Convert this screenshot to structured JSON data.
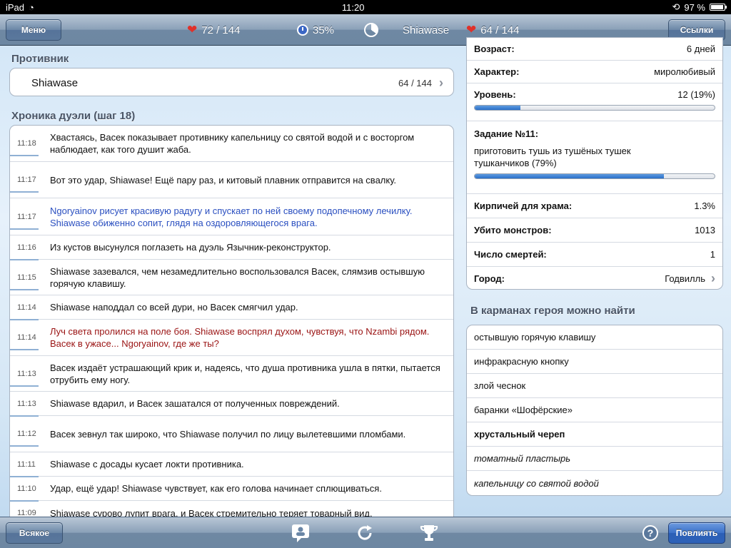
{
  "status": {
    "time": "11:20",
    "battery": "97 %"
  },
  "nav": {
    "menu_label": "Меню",
    "hero_hp": "72 / 144",
    "godpower": "35%",
    "opponent_name": "Shiawase",
    "opponent_hp": "64 / 144",
    "links_label": "Ссылки"
  },
  "opponent": {
    "title": "Противник",
    "name": "Shiawase",
    "hp": "64 / 144"
  },
  "chronicle": {
    "title": "Хроника дуэли (шаг 18)",
    "entries": [
      {
        "time": "11:18",
        "text": "Хвастаясь, Васек показывает противнику капельницу со святой водой и с восторгом наблюдает, как того душит жаба."
      },
      {
        "time": "11:17",
        "text": "Вот это удар, Shiawase! Ещё пару раз, и китовый плавник отправится на свалку."
      },
      {
        "time": "11:17",
        "text": "Ngoryainov рисует красивую радугу и спускает по ней своему подопечному лечилку. Shiawase обиженно сопит, глядя на оздоровляющегося врага."
      },
      {
        "time": "11:16",
        "text": "Из кустов высунулся поглазеть на дуэль Язычник-реконструктор."
      },
      {
        "time": "11:15",
        "text": "Shiawase зазевался, чем незамедлительно воспользовался Васек, слямзив остывшую горячую клавишу."
      },
      {
        "time": "11:14",
        "text": "Shiawase наподдал со всей дури, но Васек смягчил удар."
      },
      {
        "time": "11:14",
        "text": "Луч света пролился на поле боя. Shiawase воспрял духом, чувствуя, что Nzambi рядом. Васек в ужасе... Ngoryainov, где же ты?"
      },
      {
        "time": "11:13",
        "text": "Васек издаёт устрашающий крик и, надеясь, что душа противника ушла в пятки, пытается отрубить ему ногу."
      },
      {
        "time": "11:13",
        "text": "Shiawase вдарил, и Васек зашатался от полученных повреждений."
      },
      {
        "time": "11:12",
        "text": "Васек зевнул так широко, что Shiawase получил по лицу вылетевшими пломбами."
      },
      {
        "time": "11:11",
        "text": "Shiawase с досады кусает локти противника."
      },
      {
        "time": "11:10",
        "text": "Удар, ещё удар! Shiawase чувствует, как его голова начинает сплющиваться."
      },
      {
        "time": "11:09",
        "text": "Shiawase сурово лупит врага, и Васек стремительно теряет товарный вид."
      }
    ]
  },
  "info": {
    "age_label": "Возраст:",
    "age_value": "6 дней",
    "char_label": "Характер:",
    "char_value": "миролюбивый",
    "level_label": "Уровень:",
    "level_value": "12 (19%)",
    "level_progress": 0.19,
    "quest_label": "Задание №11:",
    "quest_text": "приготовить тушь из тушёных тушек тушканчиков (79%)",
    "quest_progress": 0.79,
    "bricks_label": "Кирпичей для храма:",
    "bricks_value": "1.3%",
    "monsters_label": "Убито монстров:",
    "monsters_value": "1013",
    "deaths_label": "Число смертей:",
    "deaths_value": "1",
    "town_label": "Город:",
    "town_value": "Годвилль"
  },
  "inventory": {
    "title": "В карманах героя можно найти",
    "items": [
      {
        "text": "остывшую горячую клавишу",
        "style": "normal"
      },
      {
        "text": "инфракрасную кнопку",
        "style": "normal"
      },
      {
        "text": "злой чеснок",
        "style": "normal"
      },
      {
        "text": "баранки «Шофёрские»",
        "style": "normal"
      },
      {
        "text": "хрустальный череп",
        "style": "bold"
      },
      {
        "text": "томатный пластырь",
        "style": "italic"
      },
      {
        "text": "капельницу со святой водой",
        "style": "italic"
      }
    ]
  },
  "toolbar": {
    "all_label": "Всякое",
    "pray_label": "Повлиять"
  },
  "colors": {
    "accent": "#2a6fc8",
    "blue_text": "#2a4fc0",
    "red_text": "#9a1313"
  }
}
